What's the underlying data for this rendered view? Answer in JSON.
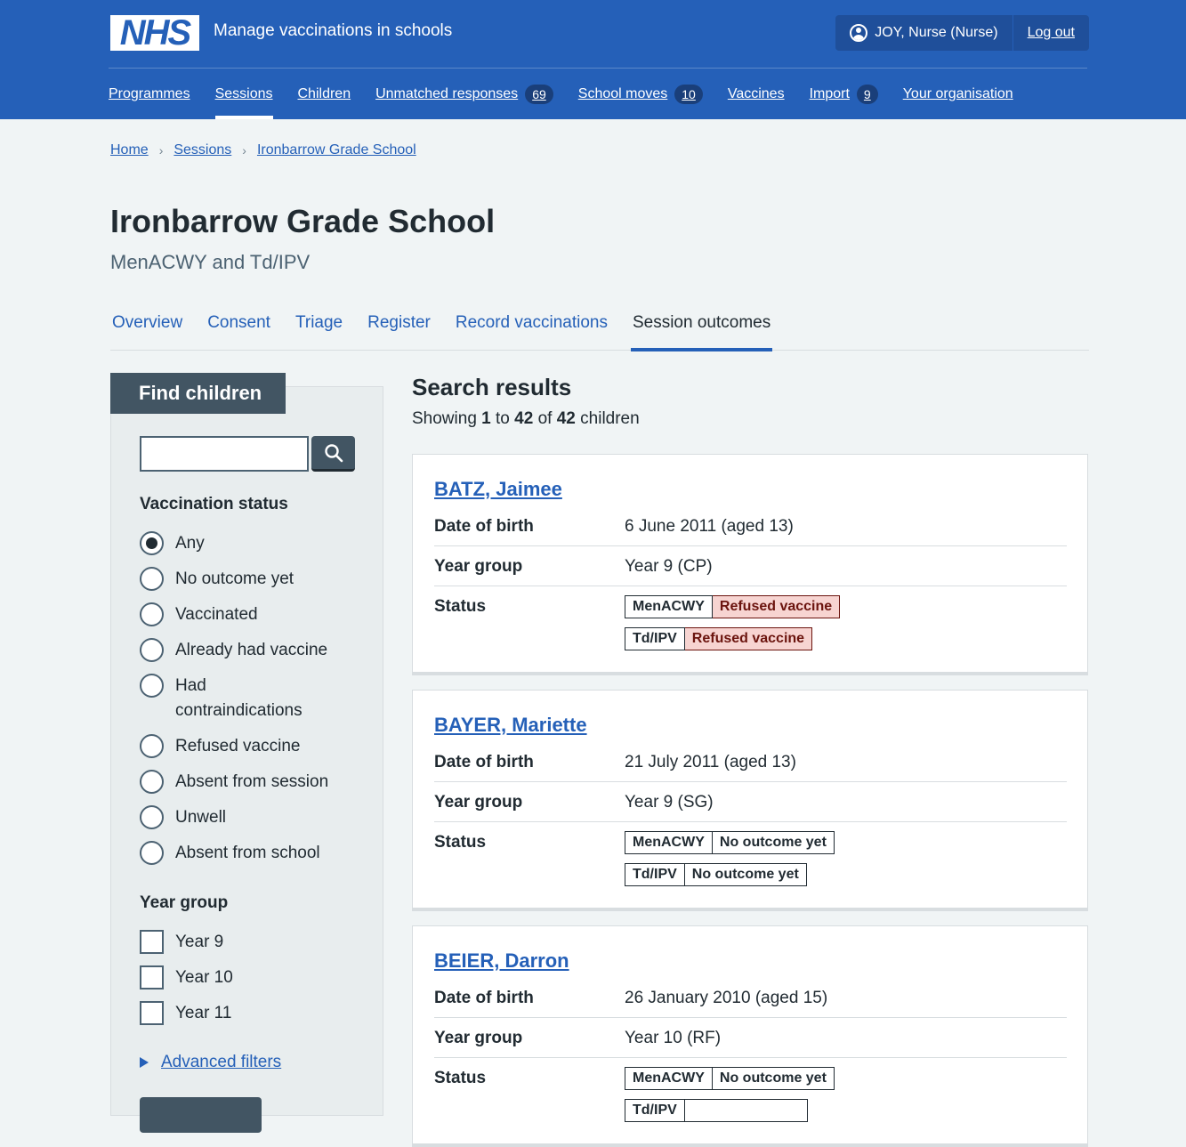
{
  "header": {
    "logo": "NHS",
    "service_name": "Manage vaccinations in schools",
    "user": "JOY, Nurse (Nurse)",
    "logout": "Log out",
    "nav": [
      {
        "label": "Programmes",
        "count": null
      },
      {
        "label": "Sessions",
        "count": null,
        "active": true
      },
      {
        "label": "Children",
        "count": null
      },
      {
        "label": "Unmatched responses",
        "count": "69"
      },
      {
        "label": "School moves",
        "count": "10"
      },
      {
        "label": "Vaccines",
        "count": null
      },
      {
        "label": "Import",
        "count": "9"
      },
      {
        "label": "Your organisation",
        "count": null
      }
    ]
  },
  "breadcrumb": [
    "Home",
    "Sessions",
    "Ironbarrow Grade School"
  ],
  "page": {
    "title": "Ironbarrow Grade School",
    "subtitle": "MenACWY and Td/IPV"
  },
  "tabs": [
    "Overview",
    "Consent",
    "Triage",
    "Register",
    "Record vaccinations",
    "Session outcomes"
  ],
  "filter": {
    "heading": "Find children",
    "search_value": "",
    "vaccination_status_label": "Vaccination status",
    "vaccination_status": [
      "Any",
      "No outcome yet",
      "Vaccinated",
      "Already had vaccine",
      "Had contraindications",
      "Refused vaccine",
      "Absent from session",
      "Unwell",
      "Absent from school"
    ],
    "selected_status": "Any",
    "year_group_label": "Year group",
    "year_groups": [
      "Year 9",
      "Year 10",
      "Year 11"
    ],
    "advanced": "Advanced filters"
  },
  "results": {
    "title": "Search results",
    "showing_prefix": "Showing",
    "from": "1",
    "to_word": "to",
    "to": "42",
    "of_word": "of",
    "total": "42",
    "suffix": "children",
    "labels": {
      "dob": "Date of birth",
      "year": "Year group",
      "status": "Status"
    },
    "children": [
      {
        "name": "BATZ, Jaimee",
        "dob": "6 June 2011 (aged 13)",
        "year": "Year 9 (CP)",
        "statuses": [
          {
            "programme": "MenACWY",
            "outcome": "Refused vaccine"
          },
          {
            "programme": "Td/IPV",
            "outcome": "Refused vaccine"
          }
        ]
      },
      {
        "name": "BAYER, Mariette",
        "dob": "21 July 2011 (aged 13)",
        "year": "Year 9 (SG)",
        "statuses": [
          {
            "programme": "MenACWY",
            "outcome": "No outcome yet"
          },
          {
            "programme": "Td/IPV",
            "outcome": "No outcome yet"
          }
        ]
      },
      {
        "name": "BEIER, Darron",
        "dob": "26 January 2010 (aged 15)",
        "year": "Year 10 (RF)",
        "statuses": [
          {
            "programme": "MenACWY",
            "outcome": "No outcome yet"
          },
          {
            "programme": "Td/IPV",
            "outcome": ""
          }
        ]
      }
    ]
  },
  "colors": {
    "brand": "#2560b8",
    "refused_bg": "#f7d4d1",
    "refused_text": "#6b140e"
  }
}
